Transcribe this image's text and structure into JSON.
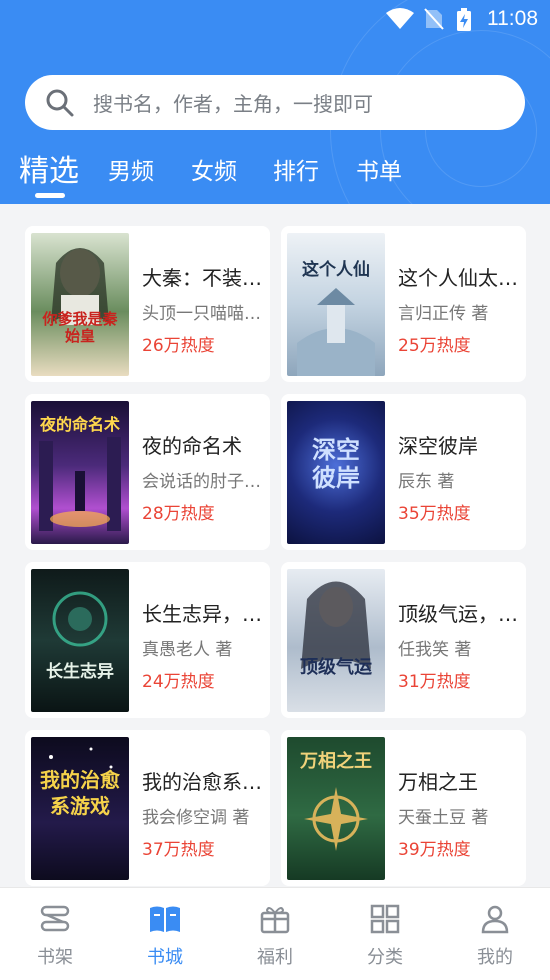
{
  "status_bar": {
    "time": "11:08"
  },
  "search": {
    "placeholder": "搜书名，作者，主角，一搜即可"
  },
  "tabs": [
    {
      "label": "精选",
      "active": true
    },
    {
      "label": "男频",
      "active": false
    },
    {
      "label": "女频",
      "active": false
    },
    {
      "label": "排行",
      "active": false
    },
    {
      "label": "书单",
      "active": false
    }
  ],
  "books": [
    {
      "title": "大秦：不装了，你爹我是秦始皇",
      "author": "头顶一只喵喵 著",
      "heat": "26万热度",
      "cover_text": "你爹我是秦始皇"
    },
    {
      "title": "这个人仙太过正经",
      "author": "言归正传 著",
      "heat": "25万热度",
      "cover_text": "这个人仙"
    },
    {
      "title": "夜的命名术",
      "author": "会说话的肘子 著",
      "heat": "28万热度",
      "cover_text": "夜的命名术"
    },
    {
      "title": "深空彼岸",
      "author": "辰东 著",
      "heat": "35万热度",
      "cover_text": "深空彼岸"
    },
    {
      "title": "长生志异，开局菜市口被斩首",
      "author": "真愚老人 著",
      "heat": "24万热度",
      "cover_text": "长生志异"
    },
    {
      "title": "顶级气运，悄悄修炼千年",
      "author": "任我笑 著",
      "heat": "31万热度",
      "cover_text": "顶级气运"
    },
    {
      "title": "我的治愈系游戏",
      "author": "我会修空调 著",
      "heat": "37万热度",
      "cover_text": "我的治愈系游戏"
    },
    {
      "title": "万相之王",
      "author": "天蚕土豆 著",
      "heat": "39万热度",
      "cover_text": "万相之王"
    }
  ],
  "bottom_nav": [
    {
      "label": "书架",
      "icon": "bookshelf-icon",
      "active": false
    },
    {
      "label": "书城",
      "icon": "open-book-icon",
      "active": true
    },
    {
      "label": "福利",
      "icon": "gift-icon",
      "active": false
    },
    {
      "label": "分类",
      "icon": "grid-icon",
      "active": false
    },
    {
      "label": "我的",
      "icon": "person-icon",
      "active": false
    }
  ],
  "colors": {
    "accent": "#3a8cf3",
    "heat": "#ea4436"
  }
}
